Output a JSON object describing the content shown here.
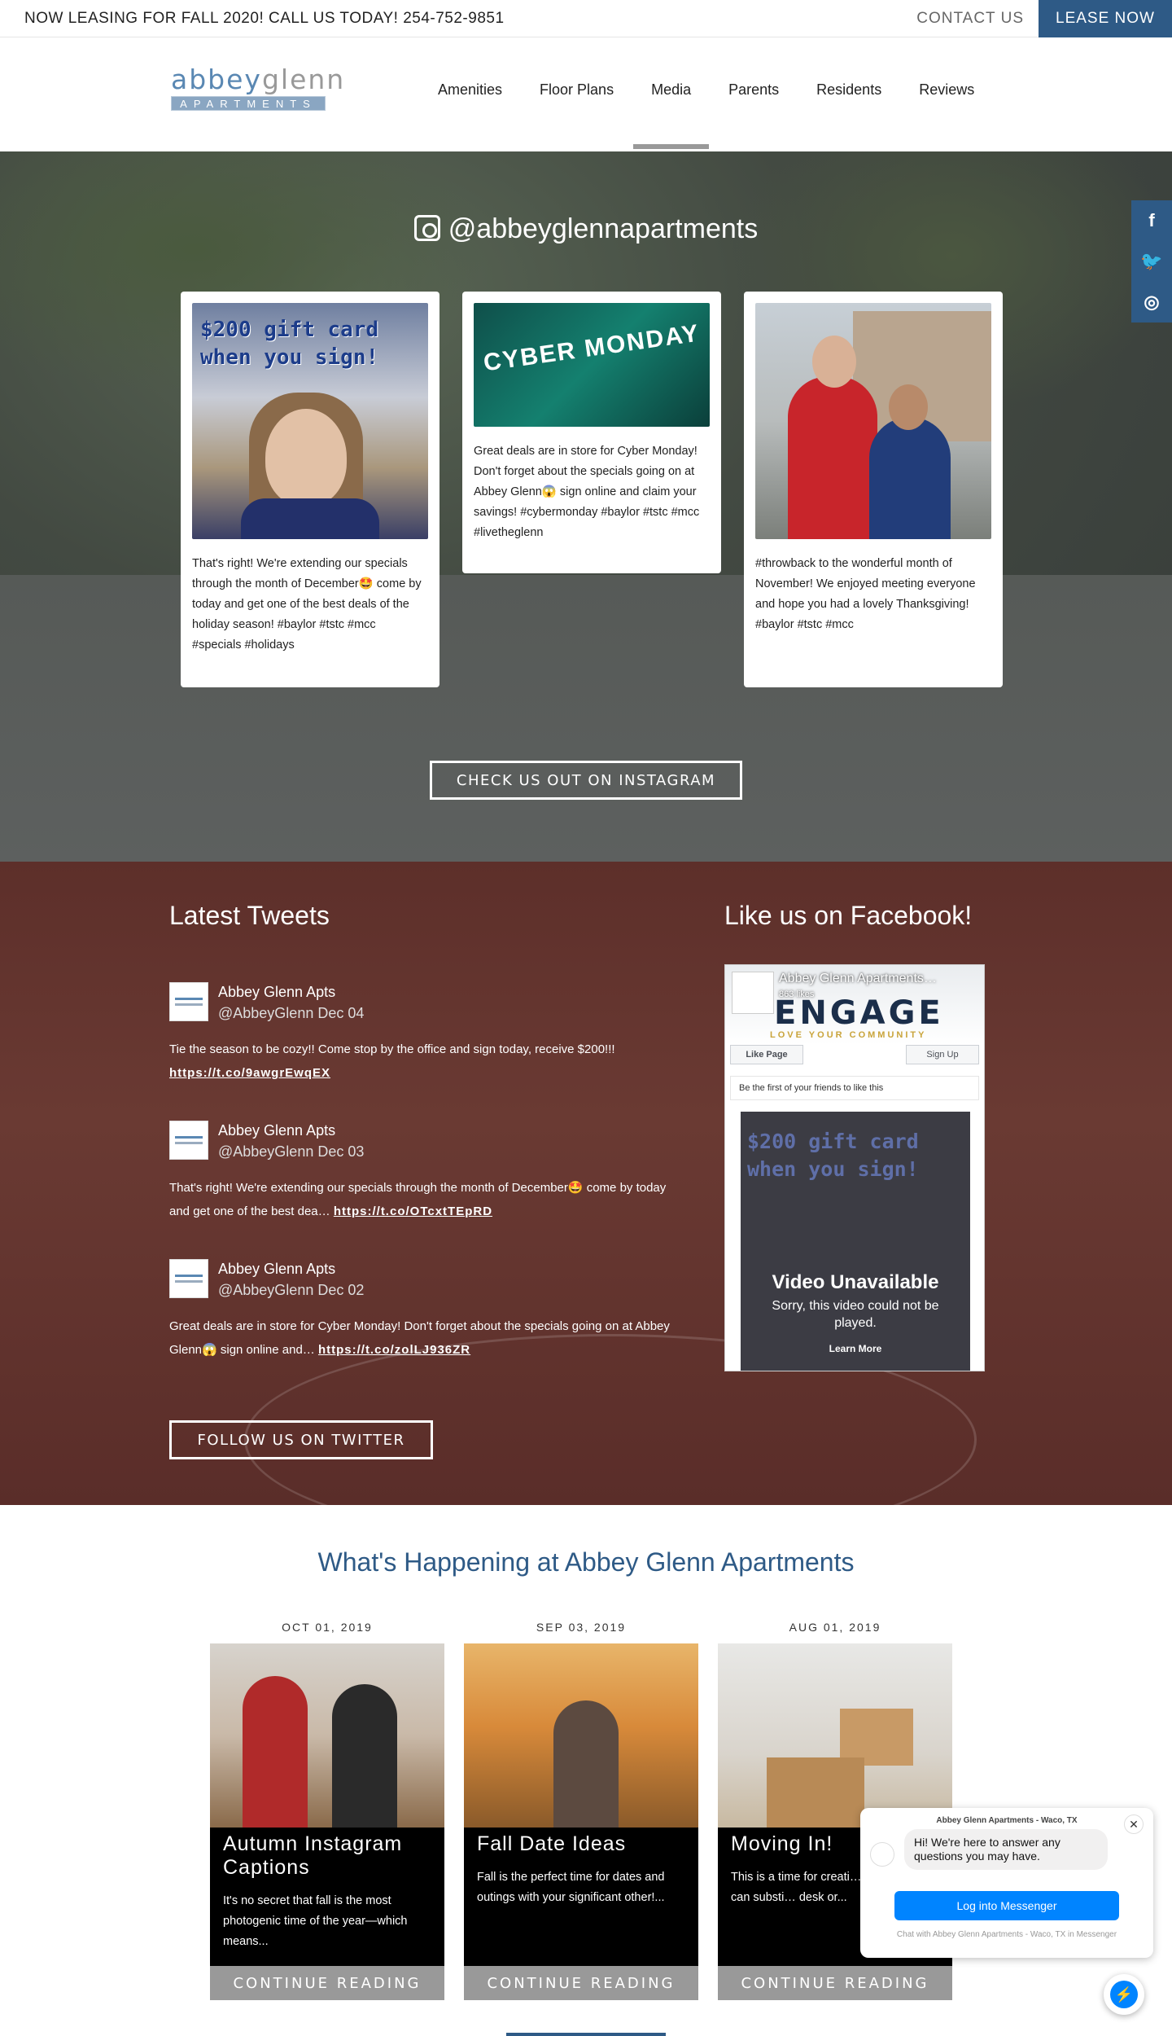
{
  "topbar": {
    "announcement": "NOW LEASING FOR FALL 2020! CALL US TODAY! 254-752-9851",
    "contact_label": "CONTACT US",
    "lease_label": "LEASE NOW"
  },
  "logo": {
    "word_a": "abbey",
    "word_b": "glenn",
    "sub": "APARTMENTS"
  },
  "nav": {
    "items": [
      "Amenities",
      "Floor Plans",
      "Media",
      "Parents",
      "Residents",
      "Reviews"
    ],
    "active": "Media"
  },
  "social": {
    "icons": [
      "facebook-icon",
      "twitter-icon",
      "instagram-icon"
    ],
    "labels": [
      "f",
      "🐦",
      "◎"
    ]
  },
  "instagram": {
    "handle": "@abbeyglennapartments",
    "posts": [
      {
        "image_text": "$200 gift card when you sign!",
        "caption": "That's right! We're extending our specials through the month of December🤩 come by today and get one of the best deals of the holiday season! #baylor #tstc #mcc #specials #holidays"
      },
      {
        "image_text": "CYBER MONDAY",
        "caption": "Great deals are in store for Cyber Monday! Don't forget about the specials going on at Abbey Glenn😱 sign online and claim your savings! #cybermonday #baylor #tstc #mcc #livetheglenn"
      },
      {
        "image_text": "",
        "caption": "#throwback to the wonderful month of November! We enjoyed meeting everyone and hope you had a lovely Thanksgiving! #baylor #tstc #mcc"
      }
    ],
    "button_label": "CHECK US OUT ON INSTAGRAM"
  },
  "twitter": {
    "heading": "Latest Tweets",
    "tweets": [
      {
        "name": "Abbey Glenn Apts",
        "handle": "@AbbeyGlenn Dec 04",
        "text": "Tie the season to be cozy!! Come stop by the office and sign today, receive $200!!! ",
        "link": "https://t.co/9awgrEwqEX"
      },
      {
        "name": "Abbey Glenn Apts",
        "handle": "@AbbeyGlenn Dec 03",
        "text": "That's right! We're extending our specials through the month of December🤩 come by today and get one of the best dea… ",
        "link": "https://t.co/OTcxtTEpRD"
      },
      {
        "name": "Abbey Glenn Apts",
        "handle": "@AbbeyGlenn Dec 02",
        "text": "Great deals are in store for Cyber Monday! Don't forget about the specials going on at Abbey Glenn😱 sign online and… ",
        "link": "https://t.co/zolLJ936ZR"
      }
    ],
    "button_label": "FOLLOW US ON TWITTER"
  },
  "facebook": {
    "heading": "Like us on Facebook!",
    "page_name": "Abbey Glenn Apartments…",
    "likes": "863 likes",
    "cover_title": "ENGAGE",
    "cover_sub": "LOVE YOUR COMMUNITY",
    "like_label": "Like Page",
    "signup_label": "Sign Up",
    "friends_text": "Be the first of your friends to like this",
    "video_text": "$200 gift card when you sign!",
    "video_unavailable": "Video Unavailable",
    "video_sorry": "Sorry, this video could not be played.",
    "learn_more": "Learn More"
  },
  "blog": {
    "heading": "What's Happening at Abbey Glenn Apartments",
    "posts": [
      {
        "date": "OCT 01, 2019",
        "title": "Autumn Instagram Captions",
        "excerpt": "It's no secret that fall is the most photogenic time of the year—which means...",
        "more": "CONTINUE READING"
      },
      {
        "date": "SEP 03, 2019",
        "title": "Fall Date Ideas",
        "excerpt": "Fall is the perfect time for dates and outings with your significant other!...",
        "more": "CONTINUE READING"
      },
      {
        "date": "AUG 01, 2019",
        "title": "Moving In!",
        "excerpt": "This is a time for creati… dining table can substi… desk or...",
        "more": "CONTINUE READING"
      }
    ]
  },
  "chat": {
    "header": "Abbey Glenn Apartments - Waco, TX",
    "message": "Hi! We're here to answer any questions you may have.",
    "button": "Log into Messenger",
    "footer": "Chat with Abbey Glenn Apartments - Waco, TX in Messenger",
    "close": "✕",
    "fab_glyph": "⚡"
  }
}
